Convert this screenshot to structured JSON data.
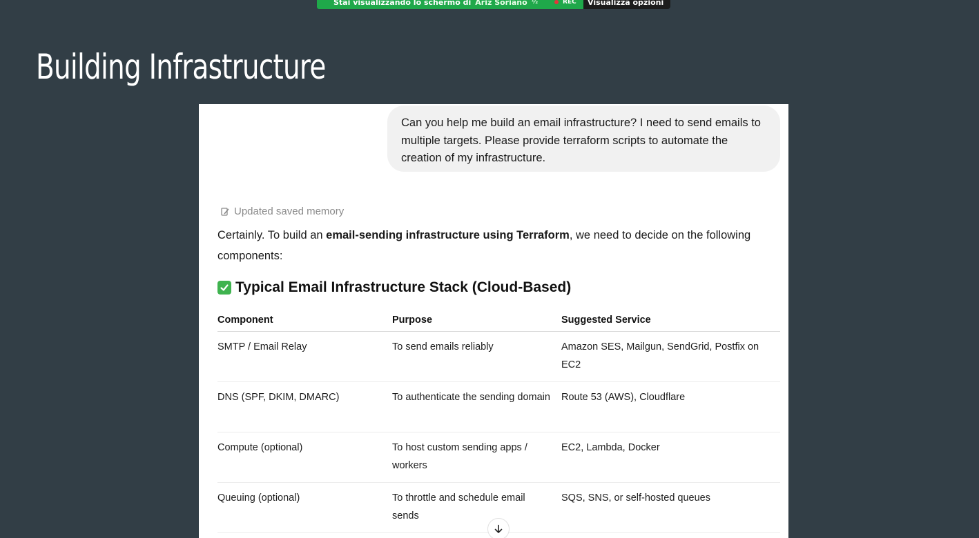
{
  "share_banner": {
    "text": "Stai visualizzando lo schermo di",
    "presenter": "Ariz Soriano",
    "indicator": "½",
    "rec": "REC",
    "options": "Visualizza opzioni"
  },
  "slide": {
    "title": "Building Infrastructure"
  },
  "chat": {
    "user_message": "Can you help me build an email infrastructure? I need to send emails to multiple targets. Please provide terraform scripts to automate the creation of my infrastructure.",
    "memory_note": "Updated saved memory",
    "intro": {
      "before": "Certainly. To build an ",
      "bold": "email-sending infrastructure using Terraform",
      "after": ", we need to decide on the following components:"
    },
    "section": {
      "icon": "check-mark-icon",
      "title": "Typical Email Infrastructure Stack (Cloud-Based)"
    },
    "table": {
      "headers": [
        "Component",
        "Purpose",
        "Suggested Service"
      ],
      "rows": [
        [
          "SMTP / Email Relay",
          "To send emails reliably",
          "Amazon SES, Mailgun, SendGrid, Postfix on EC2"
        ],
        [
          "DNS (SPF, DKIM, DMARC)",
          "To authenticate the sending domain",
          "Route 53 (AWS), Cloudflare"
        ],
        [
          "Compute (optional)",
          "To host custom sending apps / workers",
          "EC2, Lambda, Docker"
        ],
        [
          "Queuing (optional)",
          "To throttle and schedule email sends",
          "SQS, SNS, or self-hosted queues"
        ]
      ]
    },
    "scroll_icon": "arrow-down-icon"
  },
  "colors": {
    "slide_background": "#323e46",
    "banner_green": "#1fa84a",
    "rec_red": "#e8333a",
    "check_green": "#3fb34f"
  }
}
